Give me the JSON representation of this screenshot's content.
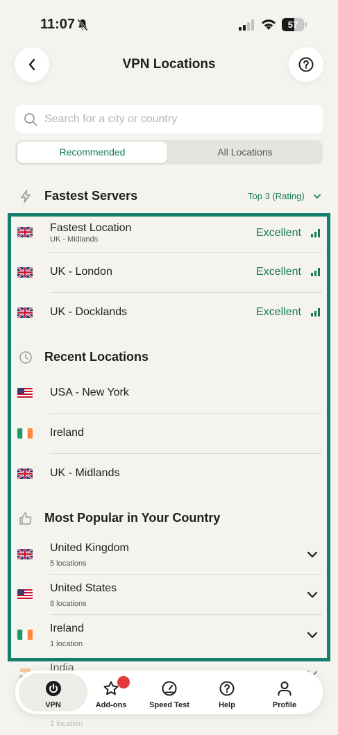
{
  "status_bar": {
    "time": "11:07",
    "battery": "57",
    "battery_level": 0.57
  },
  "header": {
    "title": "VPN Locations"
  },
  "search": {
    "placeholder": "Search for a city or country"
  },
  "tabs": [
    {
      "label": "Recommended",
      "active": true
    },
    {
      "label": "All Locations",
      "active": false
    }
  ],
  "fastest": {
    "title": "Fastest Servers",
    "filter_label": "Top 3 (Rating)",
    "items": [
      {
        "name": "Fastest Location",
        "sub": "UK - Midlands",
        "rating": "Excellent",
        "flag": "uk"
      },
      {
        "name": "UK - London",
        "rating": "Excellent",
        "flag": "uk"
      },
      {
        "name": "UK - Docklands",
        "rating": "Excellent",
        "flag": "uk"
      }
    ]
  },
  "recent": {
    "title": "Recent Locations",
    "items": [
      {
        "name": "USA - New York",
        "flag": "us"
      },
      {
        "name": "Ireland",
        "flag": "ie"
      },
      {
        "name": "UK - Midlands",
        "flag": "uk"
      }
    ]
  },
  "popular": {
    "title": "Most Popular in Your Country",
    "items": [
      {
        "name": "United Kingdom",
        "sub": "5 locations",
        "flag": "uk"
      },
      {
        "name": "United States",
        "sub": "8 locations",
        "flag": "us"
      },
      {
        "name": "Ireland",
        "sub": "1 location",
        "flag": "ie"
      },
      {
        "name": "India",
        "sub": "1 location",
        "flag": "in"
      }
    ]
  },
  "nav": [
    {
      "label": "VPN",
      "icon": "power-icon"
    },
    {
      "label": "Add-ons",
      "icon": "star-icon"
    },
    {
      "label": "Speed Test",
      "icon": "speedometer-icon"
    },
    {
      "label": "Help",
      "icon": "help-icon"
    },
    {
      "label": "Profile",
      "icon": "profile-icon"
    }
  ],
  "colors": {
    "accent": "#157a5a",
    "highlight": "#12806a",
    "badge": "#e23a3a",
    "background": "#f5f3ee"
  }
}
